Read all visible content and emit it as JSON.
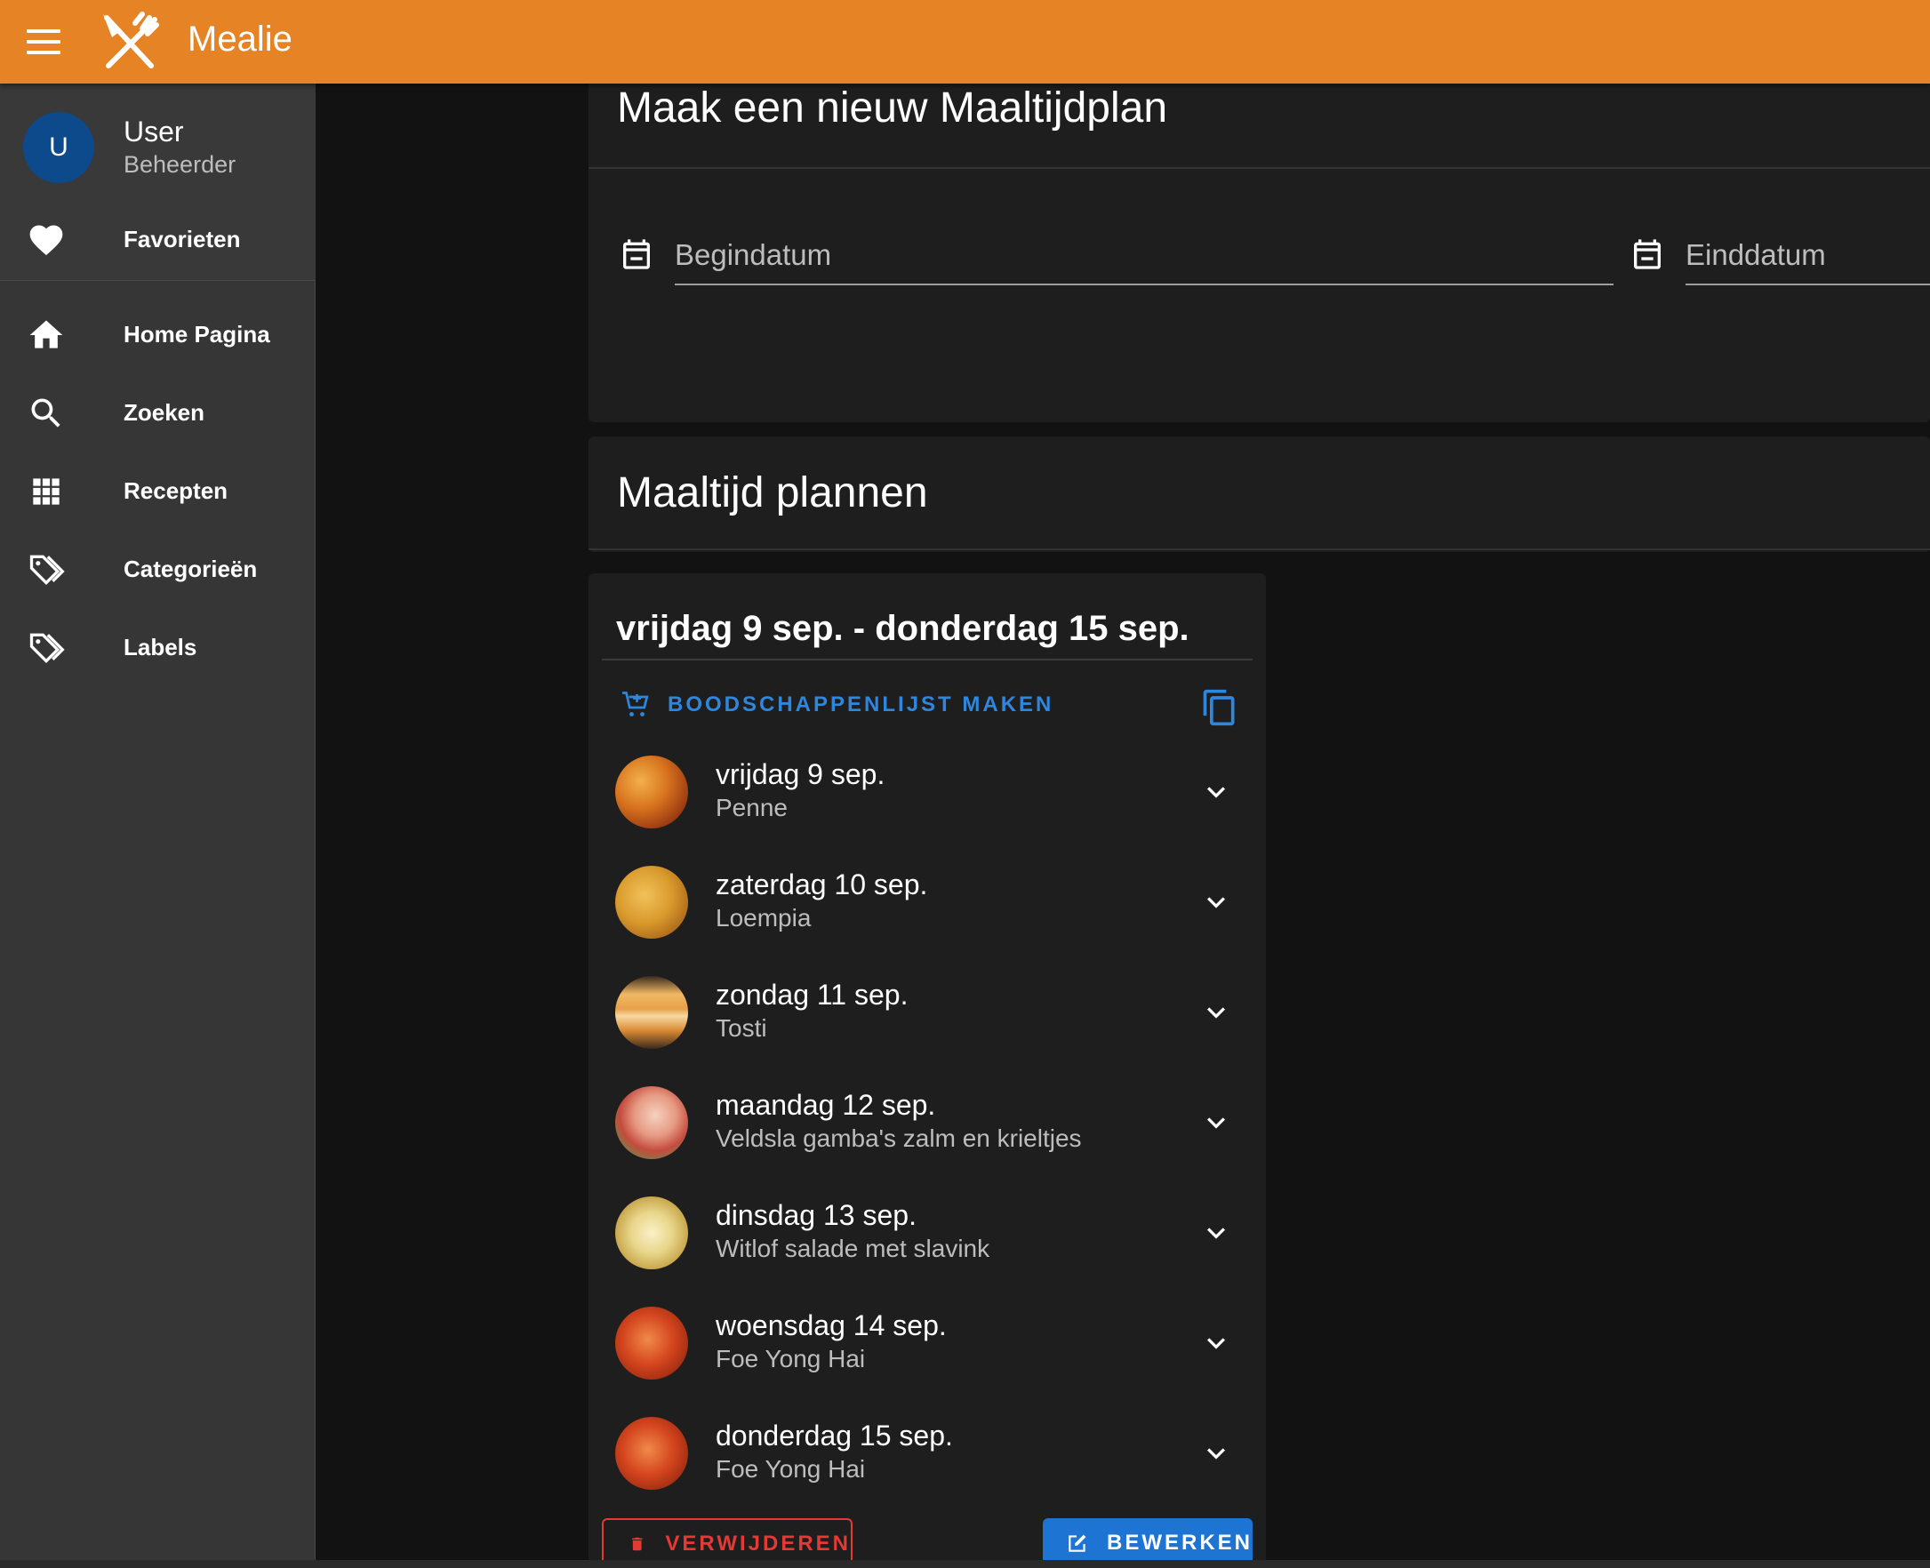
{
  "app": {
    "title": "Mealie",
    "accent": "#e58325"
  },
  "user": {
    "initial": "U",
    "name": "User",
    "role": "Beheerder"
  },
  "drawer": {
    "favorites": {
      "label": "Favorieten",
      "icon": "heart-icon"
    },
    "items": [
      {
        "label": "Home Pagina",
        "icon": "home-icon"
      },
      {
        "label": "Zoeken",
        "icon": "search-icon"
      },
      {
        "label": "Recepten",
        "icon": "grid-icon"
      },
      {
        "label": "Categorieën",
        "icon": "tags-icon"
      },
      {
        "label": "Labels",
        "icon": "tags-icon"
      }
    ]
  },
  "new_plan": {
    "title": "Maak een nieuw Maaltijdplan",
    "start_placeholder": "Begindatum",
    "end_placeholder": "Einddatum"
  },
  "planner": {
    "title": "Maaltijd plannen"
  },
  "week": {
    "title": "vrijdag 9 sep. - donderdag 15 sep.",
    "shopping_label": "BOODSCHAPPENLIJST MAKEN",
    "meals": [
      {
        "day": "vrijdag 9 sep.",
        "recipe": "Penne"
      },
      {
        "day": "zaterdag 10 sep.",
        "recipe": "Loempia"
      },
      {
        "day": "zondag 11 sep.",
        "recipe": "Tosti"
      },
      {
        "day": "maandag 12 sep.",
        "recipe": "Veldsla gamba's zalm en krieltjes"
      },
      {
        "day": "dinsdag 13 sep.",
        "recipe": "Witlof salade met slavink"
      },
      {
        "day": "woensdag 14 sep.",
        "recipe": "Foe Yong Hai"
      },
      {
        "day": "donderdag 15 sep.",
        "recipe": "Foe Yong Hai"
      }
    ],
    "delete_label": "VERWIJDEREN",
    "edit_label": "BEWERKEN"
  },
  "colors": {
    "primary_blue": "#2f87dd",
    "danger": "#e53935",
    "edit_bg": "#1e74d2"
  }
}
